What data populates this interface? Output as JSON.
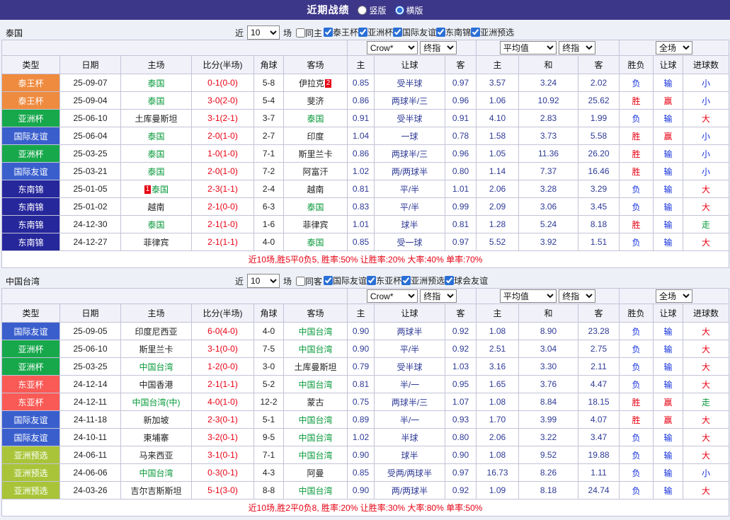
{
  "top_bar": {
    "title": "近期战绩",
    "options": [
      {
        "label": "竖版",
        "selected": false
      },
      {
        "label": "横版",
        "selected": true
      }
    ]
  },
  "palette": {
    "type_colors": {
      "泰王杯": "#ef8b3f",
      "亚洲杯": "#16a84b",
      "国际友谊": "#3a5fcd",
      "东南锦": "#26279b",
      "东亚杯": "#fa5a55",
      "亚洲预选": "#a9c438"
    },
    "result_colors": {
      "胜": "#e60012",
      "负": "#1430dc",
      "赢": "#e60012",
      "输": "#1430dc",
      "大": "#e60012",
      "小": "#1430dc",
      "走": "#0a9a3c"
    },
    "score_color": "#e60012",
    "team_highlight": "#0a9a3c",
    "odds_color": "#2e3a96"
  },
  "table_header": {
    "cols_left": [
      "类型",
      "日期",
      "主场",
      "比分(半场)",
      "角球",
      "客场"
    ],
    "odds_sub": [
      "主",
      "让球",
      "客"
    ],
    "avg_sub": [
      "主",
      "和",
      "客"
    ],
    "result_sub": [
      "胜负",
      "让球",
      "进球数"
    ],
    "selects": {
      "company": "Crow*",
      "final_a": "终指",
      "average": "平均值",
      "final_b": "终指",
      "fullmatch": "全场"
    }
  },
  "sections": [
    {
      "team": "泰国",
      "filter": {
        "near": "近",
        "count": "10",
        "games": "场",
        "same": {
          "label": "同主",
          "checked": false
        },
        "competitions": [
          {
            "label": "泰王杯",
            "checked": true
          },
          {
            "label": "亚洲杯",
            "checked": true
          },
          {
            "label": "国际友谊",
            "checked": true
          },
          {
            "label": "东南锦",
            "checked": true
          },
          {
            "label": "亚洲预选",
            "checked": true
          }
        ]
      },
      "rows": [
        {
          "type": "泰王杯",
          "date": "25-09-07",
          "home": "泰国",
          "home_hl": true,
          "home_badge": "",
          "score": "0-1(0-0)",
          "corner": "5-8",
          "away": "伊拉克",
          "away_hl": false,
          "away_badge": "2",
          "o_home": "0.85",
          "handicap": "受半球",
          "o_away": "0.97",
          "avg_home": "3.57",
          "avg_draw": "3.24",
          "avg_away": "2.02",
          "res_wdl": "负",
          "res_hcp": "输",
          "res_goal": "小"
        },
        {
          "type": "泰王杯",
          "date": "25-09-04",
          "home": "泰国",
          "home_hl": true,
          "home_badge": "",
          "score": "3-0(2-0)",
          "corner": "5-4",
          "away": "斐济",
          "away_hl": false,
          "away_badge": "",
          "o_home": "0.86",
          "handicap": "两球半/三",
          "o_away": "0.96",
          "avg_home": "1.06",
          "avg_draw": "10.92",
          "avg_away": "25.62",
          "res_wdl": "胜",
          "res_hcp": "赢",
          "res_goal": "小"
        },
        {
          "type": "亚洲杯",
          "date": "25-06-10",
          "home": "土库曼斯坦",
          "home_hl": false,
          "home_badge": "",
          "score": "3-1(2-1)",
          "corner": "3-7",
          "away": "泰国",
          "away_hl": true,
          "away_badge": "",
          "o_home": "0.91",
          "handicap": "受半球",
          "o_away": "0.91",
          "avg_home": "4.10",
          "avg_draw": "2.83",
          "avg_away": "1.99",
          "res_wdl": "负",
          "res_hcp": "输",
          "res_goal": "大"
        },
        {
          "type": "国际友谊",
          "date": "25-06-04",
          "home": "泰国",
          "home_hl": true,
          "home_badge": "",
          "score": "2-0(1-0)",
          "corner": "2-7",
          "away": "印度",
          "away_hl": false,
          "away_badge": "",
          "o_home": "1.04",
          "handicap": "一球",
          "o_away": "0.78",
          "avg_home": "1.58",
          "avg_draw": "3.73",
          "avg_away": "5.58",
          "res_wdl": "胜",
          "res_hcp": "赢",
          "res_goal": "小"
        },
        {
          "type": "亚洲杯",
          "date": "25-03-25",
          "home": "泰国",
          "home_hl": true,
          "home_badge": "",
          "score": "1-0(1-0)",
          "corner": "7-1",
          "away": "斯里兰卡",
          "away_hl": false,
          "away_badge": "",
          "o_home": "0.86",
          "handicap": "两球半/三",
          "o_away": "0.96",
          "avg_home": "1.05",
          "avg_draw": "11.36",
          "avg_away": "26.20",
          "res_wdl": "胜",
          "res_hcp": "输",
          "res_goal": "小"
        },
        {
          "type": "国际友谊",
          "date": "25-03-21",
          "home": "泰国",
          "home_hl": true,
          "home_badge": "",
          "score": "2-0(1-0)",
          "corner": "7-2",
          "away": "阿富汗",
          "away_hl": false,
          "away_badge": "",
          "o_home": "1.02",
          "handicap": "两/两球半",
          "o_away": "0.80",
          "avg_home": "1.14",
          "avg_draw": "7.37",
          "avg_away": "16.46",
          "res_wdl": "胜",
          "res_hcp": "输",
          "res_goal": "小"
        },
        {
          "type": "东南锦",
          "date": "25-01-05",
          "home": "泰国",
          "home_hl": true,
          "home_badge": "1",
          "score": "2-3(1-1)",
          "corner": "2-4",
          "away": "越南",
          "away_hl": false,
          "away_badge": "",
          "o_home": "0.81",
          "handicap": "平/半",
          "o_away": "1.01",
          "avg_home": "2.06",
          "avg_draw": "3.28",
          "avg_away": "3.29",
          "res_wdl": "负",
          "res_hcp": "输",
          "res_goal": "大"
        },
        {
          "type": "东南锦",
          "date": "25-01-02",
          "home": "越南",
          "home_hl": false,
          "home_badge": "",
          "score": "2-1(0-0)",
          "corner": "6-3",
          "away": "泰国",
          "away_hl": true,
          "away_badge": "",
          "o_home": "0.83",
          "handicap": "平/半",
          "o_away": "0.99",
          "avg_home": "2.09",
          "avg_draw": "3.06",
          "avg_away": "3.45",
          "res_wdl": "负",
          "res_hcp": "输",
          "res_goal": "大"
        },
        {
          "type": "东南锦",
          "date": "24-12-30",
          "home": "泰国",
          "home_hl": true,
          "home_badge": "",
          "score": "2-1(1-0)",
          "corner": "1-6",
          "away": "菲律宾",
          "away_hl": false,
          "away_badge": "",
          "o_home": "1.01",
          "handicap": "球半",
          "o_away": "0.81",
          "avg_home": "1.28",
          "avg_draw": "5.24",
          "avg_away": "8.18",
          "res_wdl": "胜",
          "res_hcp": "输",
          "res_goal": "走"
        },
        {
          "type": "东南锦",
          "date": "24-12-27",
          "home": "菲律宾",
          "home_hl": false,
          "home_badge": "",
          "score": "2-1(1-1)",
          "corner": "4-0",
          "away": "泰国",
          "away_hl": true,
          "away_badge": "",
          "o_home": "0.85",
          "handicap": "受一球",
          "o_away": "0.97",
          "avg_home": "5.52",
          "avg_draw": "3.92",
          "avg_away": "1.51",
          "res_wdl": "负",
          "res_hcp": "输",
          "res_goal": "大"
        }
      ],
      "summary": "近10场,胜5平0负5, 胜率:50% 让胜率:20% 大率:40% 单率:70%"
    },
    {
      "team": "中国台湾",
      "filter": {
        "near": "近",
        "count": "10",
        "games": "场",
        "same": {
          "label": "同客",
          "checked": false
        },
        "competitions": [
          {
            "label": "国际友谊",
            "checked": true
          },
          {
            "label": "东亚杯",
            "checked": true
          },
          {
            "label": "亚洲预选",
            "checked": true
          },
          {
            "label": "球会友谊",
            "checked": true
          }
        ]
      },
      "rows": [
        {
          "type": "国际友谊",
          "date": "25-09-05",
          "home": "印度尼西亚",
          "home_hl": false,
          "home_badge": "",
          "score": "6-0(4-0)",
          "corner": "4-0",
          "away": "中国台湾",
          "away_hl": true,
          "away_badge": "",
          "o_home": "0.90",
          "handicap": "两球半",
          "o_away": "0.92",
          "avg_home": "1.08",
          "avg_draw": "8.90",
          "avg_away": "23.28",
          "res_wdl": "负",
          "res_hcp": "输",
          "res_goal": "大"
        },
        {
          "type": "亚洲杯",
          "date": "25-06-10",
          "home": "斯里兰卡",
          "home_hl": false,
          "home_badge": "",
          "score": "3-1(0-0)",
          "corner": "7-5",
          "away": "中国台湾",
          "away_hl": true,
          "away_badge": "",
          "o_home": "0.90",
          "handicap": "平/半",
          "o_away": "0.92",
          "avg_home": "2.51",
          "avg_draw": "3.04",
          "avg_away": "2.75",
          "res_wdl": "负",
          "res_hcp": "输",
          "res_goal": "大"
        },
        {
          "type": "亚洲杯",
          "date": "25-03-25",
          "home": "中国台湾",
          "home_hl": true,
          "home_badge": "",
          "score": "1-2(0-0)",
          "corner": "3-0",
          "away": "土库曼斯坦",
          "away_hl": false,
          "away_badge": "",
          "o_home": "0.79",
          "handicap": "受半球",
          "o_away": "1.03",
          "avg_home": "3.16",
          "avg_draw": "3.30",
          "avg_away": "2.11",
          "res_wdl": "负",
          "res_hcp": "输",
          "res_goal": "大"
        },
        {
          "type": "东亚杯",
          "date": "24-12-14",
          "home": "中国香港",
          "home_hl": false,
          "home_badge": "",
          "score": "2-1(1-1)",
          "corner": "5-2",
          "away": "中国台湾",
          "away_hl": true,
          "away_badge": "",
          "o_home": "0.81",
          "handicap": "半/一",
          "o_away": "0.95",
          "avg_home": "1.65",
          "avg_draw": "3.76",
          "avg_away": "4.47",
          "res_wdl": "负",
          "res_hcp": "输",
          "res_goal": "大"
        },
        {
          "type": "东亚杯",
          "date": "24-12-11",
          "home": "中国台湾(中)",
          "home_hl": true,
          "home_badge": "",
          "score": "4-0(1-0)",
          "corner": "12-2",
          "away": "蒙古",
          "away_hl": false,
          "away_badge": "",
          "o_home": "0.75",
          "handicap": "两球半/三",
          "o_away": "1.07",
          "avg_home": "1.08",
          "avg_draw": "8.84",
          "avg_away": "18.15",
          "res_wdl": "胜",
          "res_hcp": "赢",
          "res_goal": "走"
        },
        {
          "type": "国际友谊",
          "date": "24-11-18",
          "home": "新加坡",
          "home_hl": false,
          "home_badge": "",
          "score": "2-3(0-1)",
          "corner": "5-1",
          "away": "中国台湾",
          "away_hl": true,
          "away_badge": "",
          "o_home": "0.89",
          "handicap": "半/一",
          "o_away": "0.93",
          "avg_home": "1.70",
          "avg_draw": "3.99",
          "avg_away": "4.07",
          "res_wdl": "胜",
          "res_hcp": "赢",
          "res_goal": "大"
        },
        {
          "type": "国际友谊",
          "date": "24-10-11",
          "home": "柬埔寨",
          "home_hl": false,
          "home_badge": "",
          "score": "3-2(0-1)",
          "corner": "9-5",
          "away": "中国台湾",
          "away_hl": true,
          "away_badge": "",
          "o_home": "1.02",
          "handicap": "半球",
          "o_away": "0.80",
          "avg_home": "2.06",
          "avg_draw": "3.22",
          "avg_away": "3.47",
          "res_wdl": "负",
          "res_hcp": "输",
          "res_goal": "大"
        },
        {
          "type": "亚洲预选",
          "date": "24-06-11",
          "home": "马来西亚",
          "home_hl": false,
          "home_badge": "",
          "score": "3-1(0-1)",
          "corner": "7-1",
          "away": "中国台湾",
          "away_hl": true,
          "away_badge": "",
          "o_home": "0.90",
          "handicap": "球半",
          "o_away": "0.90",
          "avg_home": "1.08",
          "avg_draw": "9.52",
          "avg_away": "19.88",
          "res_wdl": "负",
          "res_hcp": "输",
          "res_goal": "大"
        },
        {
          "type": "亚洲预选",
          "date": "24-06-06",
          "home": "中国台湾",
          "home_hl": true,
          "home_badge": "",
          "score": "0-3(0-1)",
          "corner": "4-3",
          "away": "阿曼",
          "away_hl": false,
          "away_badge": "",
          "o_home": "0.85",
          "handicap": "受两/两球半",
          "o_away": "0.97",
          "avg_home": "16.73",
          "avg_draw": "8.26",
          "avg_away": "1.11",
          "res_wdl": "负",
          "res_hcp": "输",
          "res_goal": "小"
        },
        {
          "type": "亚洲预选",
          "date": "24-03-26",
          "home": "吉尔吉斯斯坦",
          "home_hl": false,
          "home_badge": "",
          "score": "5-1(3-0)",
          "corner": "8-8",
          "away": "中国台湾",
          "away_hl": true,
          "away_badge": "",
          "o_home": "0.90",
          "handicap": "两/两球半",
          "o_away": "0.92",
          "avg_home": "1.09",
          "avg_draw": "8.18",
          "avg_away": "24.74",
          "res_wdl": "负",
          "res_hcp": "输",
          "res_goal": "大"
        }
      ],
      "summary": "近10场,胜2平0负8, 胜率:20% 让胜率:30% 大率:80% 单率:50%"
    }
  ]
}
